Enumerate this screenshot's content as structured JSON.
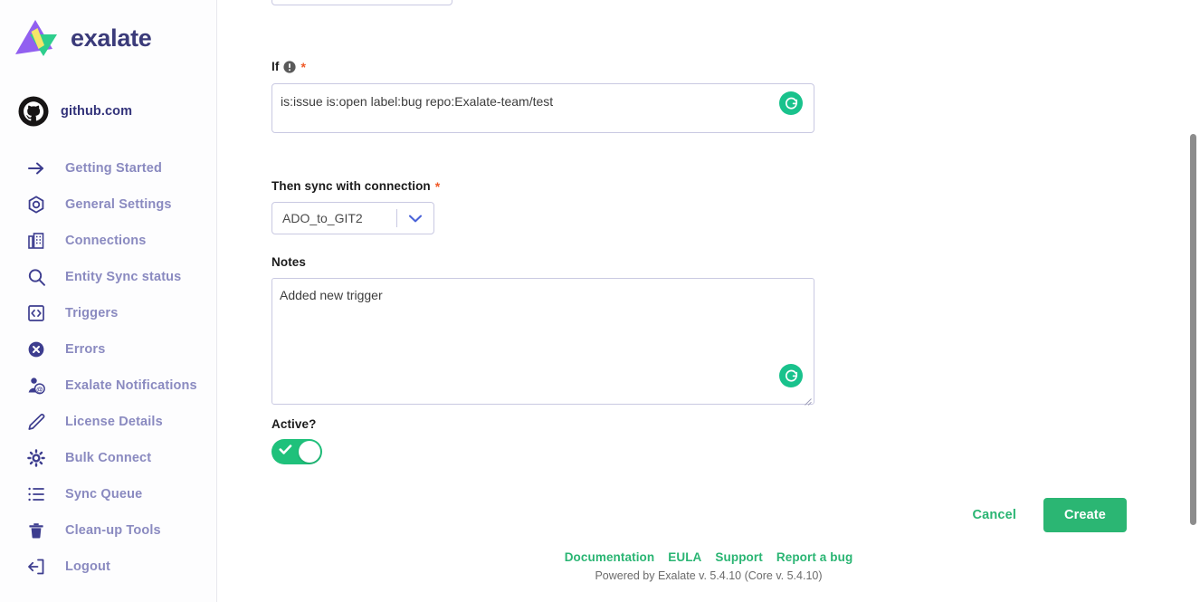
{
  "brand": {
    "name": "exalate",
    "logo_icon": "exalate-triangles-logo",
    "colors": {
      "purple": "#9260f0",
      "green": "#2ece8d",
      "yellow": "#f5e66a"
    }
  },
  "sidebar": {
    "instance": {
      "label": "github.com",
      "icon": "github-icon"
    },
    "items": [
      {
        "label": "Getting Started",
        "icon": "arrow-right-icon"
      },
      {
        "label": "General Settings",
        "icon": "gear-hex-icon"
      },
      {
        "label": "Connections",
        "icon": "building-icon"
      },
      {
        "label": "Entity Sync status",
        "icon": "search-icon"
      },
      {
        "label": "Triggers",
        "icon": "code-brackets-icon"
      },
      {
        "label": "Errors",
        "icon": "error-x-circle-icon"
      },
      {
        "label": "Exalate Notifications",
        "icon": "user-at-icon"
      },
      {
        "label": "License Details",
        "icon": "pencil-icon"
      },
      {
        "label": "Bulk Connect",
        "icon": "gear-icon"
      },
      {
        "label": "Sync Queue",
        "icon": "list-icon"
      },
      {
        "label": "Clean-up Tools",
        "icon": "trash-icon"
      },
      {
        "label": "Logout",
        "icon": "logout-icon"
      }
    ]
  },
  "form": {
    "if_field": {
      "label": "If",
      "info_icon": "info-circle-icon",
      "required_marker": "*",
      "value": "is:issue is:open label:bug repo:Exalate-team/test",
      "placeholder": "",
      "reload_icon": "refresh-circle-icon"
    },
    "connection_field": {
      "label": "Then sync with connection",
      "required_marker": "*",
      "value": "ADO_to_GIT2",
      "chevron_icon": "chevron-down-icon"
    },
    "notes_field": {
      "label": "Notes",
      "value": "Added new trigger",
      "placeholder": "",
      "reload_icon": "refresh-circle-icon",
      "resize_icon": "resize-grip-icon"
    },
    "active_field": {
      "label": "Active?",
      "state": "on",
      "check_icon": "check-icon"
    }
  },
  "actions": {
    "cancel_label": "Cancel",
    "create_label": "Create"
  },
  "footer": {
    "links": [
      {
        "label": "Documentation"
      },
      {
        "label": "EULA"
      },
      {
        "label": "Support"
      },
      {
        "label": "Report a bug"
      }
    ],
    "powered_by": "Powered by Exalate v. 5.4.10 (Core v. 5.4.10)"
  },
  "colors": {
    "accent_green": "#2bb673",
    "toggle_green": "#1fc17b",
    "reload_green": "#19c28c",
    "nav_text": "#8a8ac0",
    "nav_icon": "#3d3d8f",
    "required_red": "#f05a28",
    "brand_text": "#3b3b7a"
  }
}
